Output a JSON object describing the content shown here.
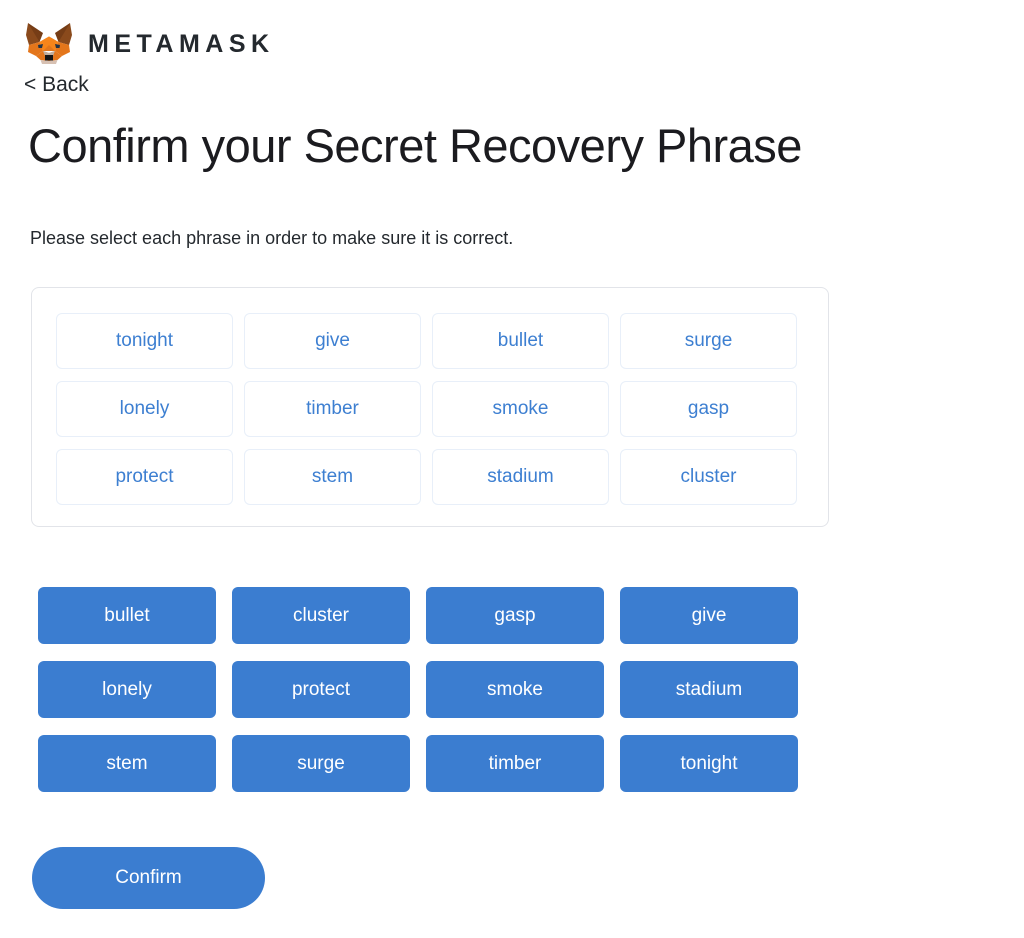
{
  "brand": {
    "logo_icon": "metamask-fox-icon",
    "wordmark": "METAMASK",
    "back_label": "< Back"
  },
  "page": {
    "title": "Confirm your Secret Recovery Phrase",
    "subtitle": "Please select each phrase in order to make sure it is correct."
  },
  "selected_panel": {
    "slots": [
      {
        "word": "tonight"
      },
      {
        "word": "give"
      },
      {
        "word": "bullet"
      },
      {
        "word": "surge"
      },
      {
        "word": "lonely"
      },
      {
        "word": "timber"
      },
      {
        "word": "smoke"
      },
      {
        "word": "gasp"
      },
      {
        "word": "protect"
      },
      {
        "word": "stem"
      },
      {
        "word": "stadium"
      },
      {
        "word": "cluster"
      }
    ]
  },
  "word_bank": {
    "words": [
      {
        "word": "bullet"
      },
      {
        "word": "cluster"
      },
      {
        "word": "gasp"
      },
      {
        "word": "give"
      },
      {
        "word": "lonely"
      },
      {
        "word": "protect"
      },
      {
        "word": "smoke"
      },
      {
        "word": "stadium"
      },
      {
        "word": "stem"
      },
      {
        "word": "surge"
      },
      {
        "word": "timber"
      },
      {
        "word": "tonight"
      }
    ]
  },
  "actions": {
    "confirm_label": "Confirm"
  },
  "colors": {
    "accent_blue": "#3b7dd0",
    "chip_text_blue": "#3d7fd1",
    "chip_border": "#e8eff9",
    "panel_border": "#e2e4e9",
    "text_dark": "#24292e",
    "background": "#ffffff"
  }
}
